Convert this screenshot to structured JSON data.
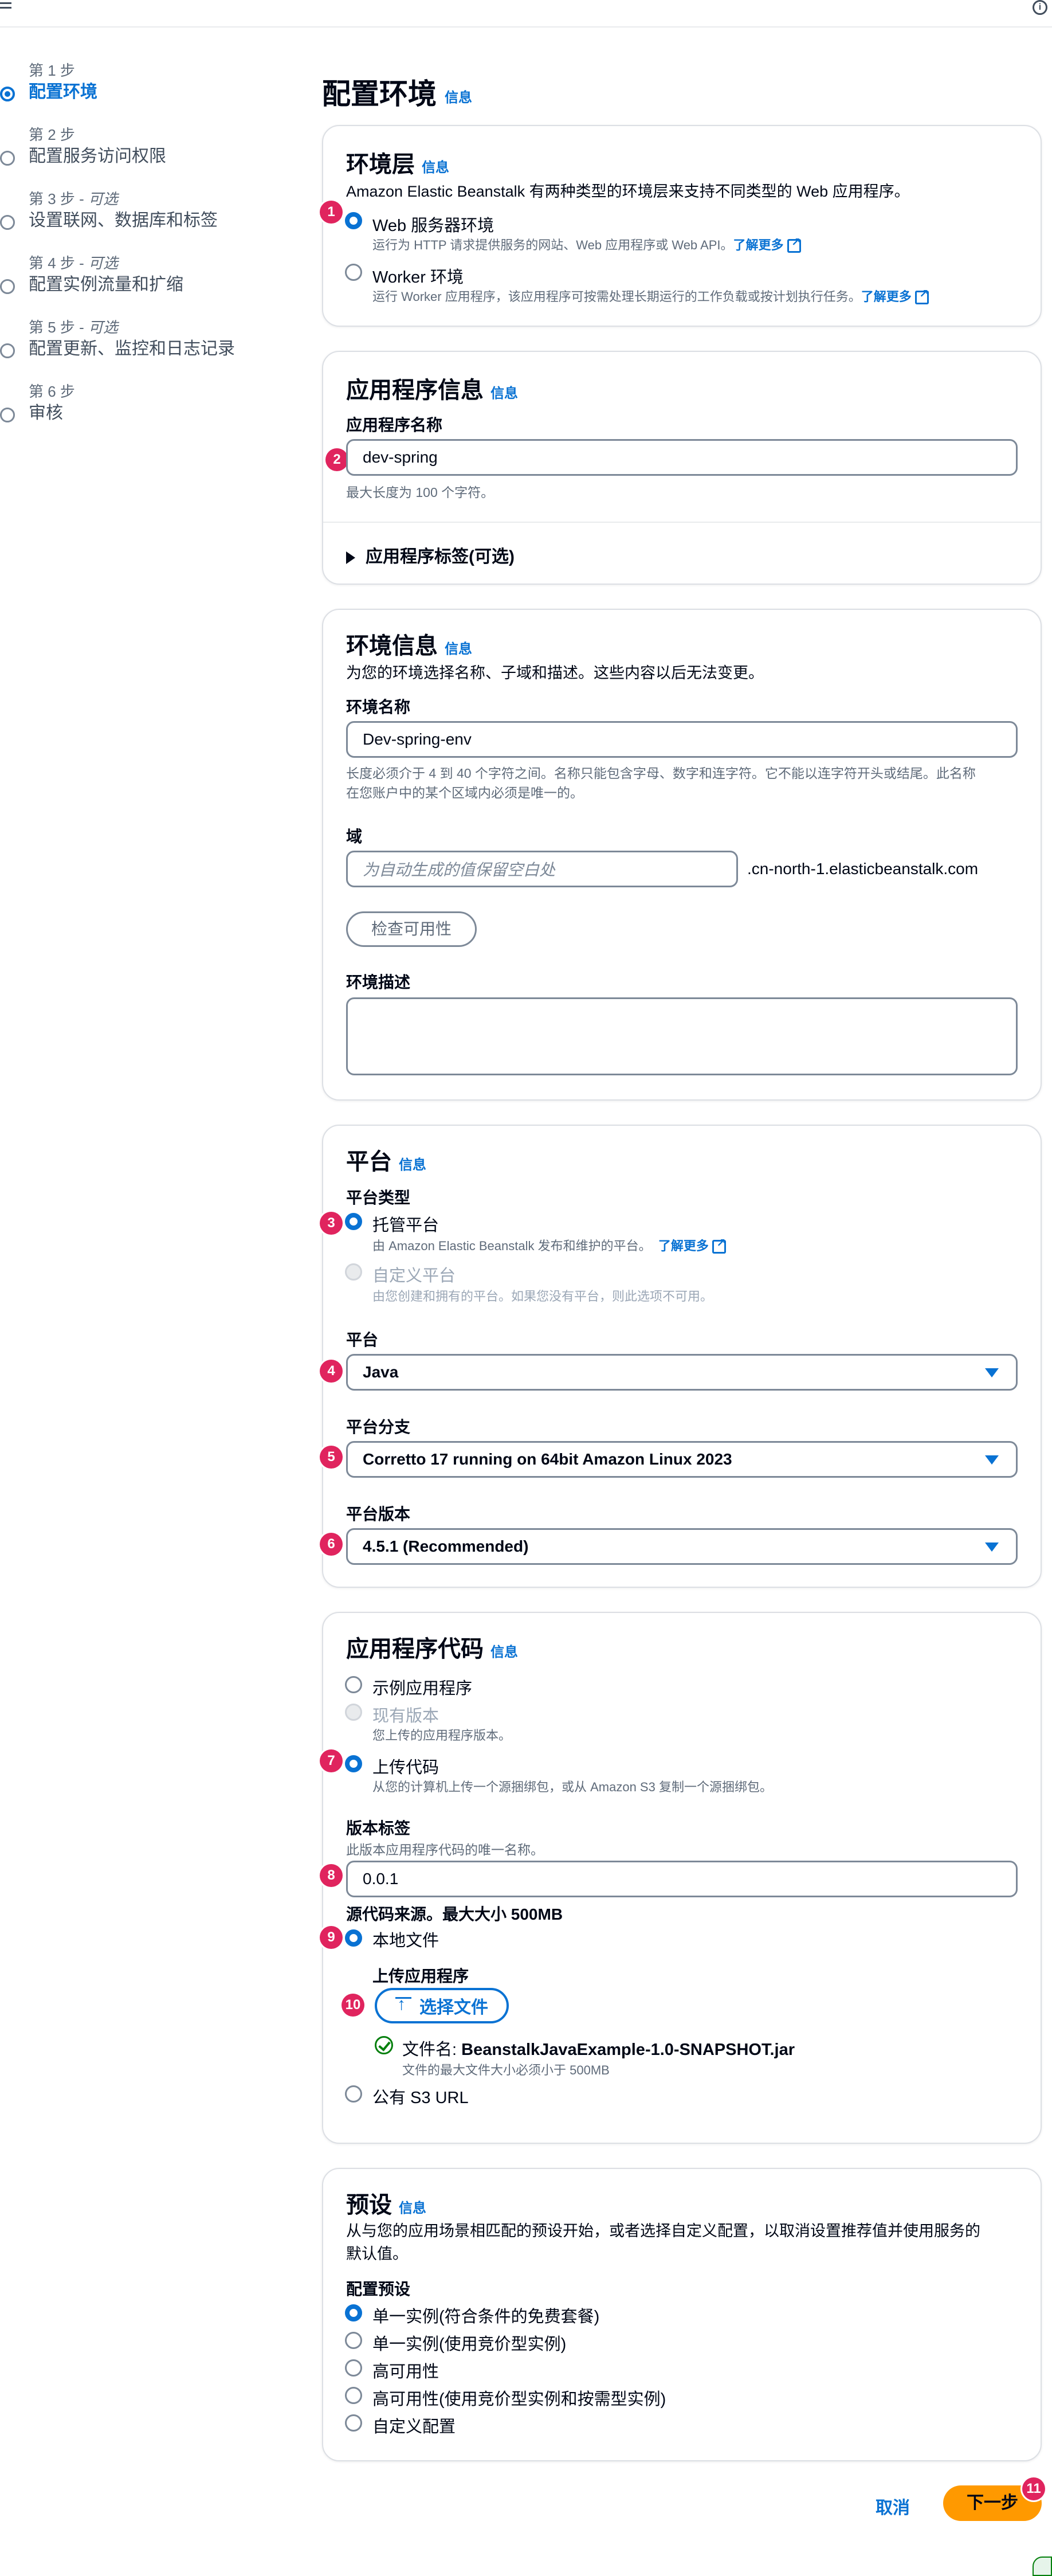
{
  "header": {
    "info_icon": "i"
  },
  "steps": [
    {
      "label": "第 1 步",
      "optional": "",
      "title": "配置环境",
      "active": true
    },
    {
      "label": "第 2 步",
      "optional": "",
      "title": "配置服务访问权限"
    },
    {
      "label": "第 3 步 - ",
      "optional": "可选",
      "title": "设置联网、数据库和标签"
    },
    {
      "label": "第 4 步 - ",
      "optional": "可选",
      "title": "配置实例流量和扩缩"
    },
    {
      "label": "第 5 步 - ",
      "optional": "可选",
      "title": "配置更新、监控和日志记录"
    },
    {
      "label": "第 6 步",
      "optional": "",
      "title": "审核"
    }
  ],
  "page": {
    "title": "配置环境",
    "info": "信息"
  },
  "env_tier": {
    "title": "环境层",
    "info": "信息",
    "desc": "Amazon Elastic Beanstalk 有两种类型的环境层来支持不同类型的 Web 应用程序。",
    "web_label": "Web 服务器环境",
    "web_desc": "运行为 HTTP 请求提供服务的网站、Web 应用程序或 Web API。",
    "worker_label": "Worker 环境",
    "worker_desc": "运行 Worker 应用程序，该应用程序可按需处理长期运行的工作负载或按计划执行任务。",
    "learn_more": "了解更多"
  },
  "app_info": {
    "title": "应用程序信息",
    "info": "信息",
    "name_label": "应用程序名称",
    "name_value": "dev-spring",
    "name_hint": "最大长度为 100 个字符。",
    "tags_label": "应用程序标签(可选)"
  },
  "env_info": {
    "title": "环境信息",
    "info": "信息",
    "desc": "为您的环境选择名称、子域和描述。这些内容以后无法变更。",
    "name_label": "环境名称",
    "name_value": "Dev-spring-env",
    "name_hint_1": "长度必须介于 4 到 40 个字符之间。名称只能包含字母、数字和连字符。它不能以连字符开头或结尾。此名称",
    "name_hint_2": "在您账户中的某个区域内必须是唯一的。",
    "domain_label": "域",
    "domain_placeholder": "为自动生成的值保留空白处",
    "domain_suffix": ".cn-north-1.elasticbeanstalk.com",
    "check_button": "检查可用性",
    "desc_label": "环境描述"
  },
  "platform": {
    "title": "平台",
    "info": "信息",
    "type_label": "平台类型",
    "managed_label": "托管平台",
    "managed_desc": "由 Amazon Elastic Beanstalk 发布和维护的平台。",
    "learn_more": "了解更多",
    "custom_label": "自定义平台",
    "custom_desc": "由您创建和拥有的平台。如果您没有平台，则此选项不可用。",
    "platform_label": "平台",
    "platform_value": "Java",
    "branch_label": "平台分支",
    "branch_value": "Corretto 17 running on 64bit Amazon Linux 2023",
    "version_label": "平台版本",
    "version_value": "4.5.1 (Recommended)"
  },
  "app_code": {
    "title": "应用程序代码",
    "info": "信息",
    "sample_label": "示例应用程序",
    "existing_label": "现有版本",
    "existing_desc": "您上传的应用程序版本。",
    "upload_label": "上传代码",
    "upload_desc": "从您的计算机上传一个源捆绑包，或从 Amazon S3 复制一个源捆绑包。",
    "version_label_title": "版本标签",
    "version_label_desc": "此版本应用程序代码的唯一名称。",
    "version_label_value": "0.0.1",
    "source_title": "源代码来源。最大大小 500MB",
    "local_label": "本地文件",
    "upload_app_label": "上传应用程序",
    "choose_file": "选择文件",
    "file_name_prefix": "文件名: ",
    "file_name": "BeanstalkJavaExample-1.0-SNAPSHOT.jar",
    "file_hint": "文件的最大文件大小必须小于 500MB",
    "s3_label": "公有 S3 URL"
  },
  "presets": {
    "title": "预设",
    "info": "信息",
    "desc_1": "从与您的应用场景相匹配的预设开始，或者选择自定义配置，以取消设置推荐值并使用服务的",
    "desc_2": "默认值。",
    "label": "配置预设",
    "options": [
      "单一实例(符合条件的免费套餐)",
      "单一实例(使用竞价型实例)",
      "高可用性",
      "高可用性(使用竞价型实例和按需型实例)",
      "自定义配置"
    ]
  },
  "footer": {
    "cancel": "取消",
    "next": "下一步"
  },
  "badges": [
    "1",
    "2",
    "3",
    "4",
    "5",
    "6",
    "7",
    "8",
    "9",
    "10",
    "11"
  ],
  "colors": {
    "accent": "#0972d3",
    "primary_button": "#ff9900",
    "badge": "#e0245e",
    "success": "#037f0c"
  }
}
